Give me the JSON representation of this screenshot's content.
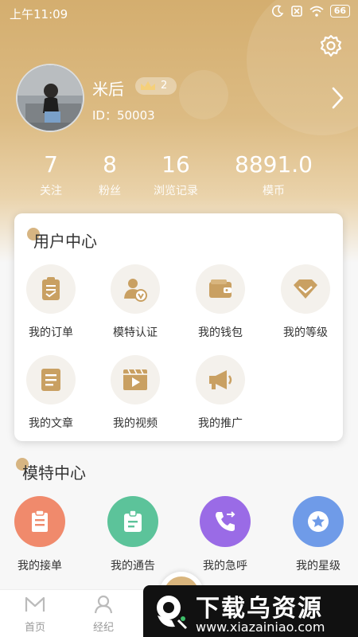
{
  "status_bar": {
    "time": "上午11:09",
    "battery": "66"
  },
  "profile": {
    "name": "米后",
    "vip_level": "2",
    "id_text": "ID：50003"
  },
  "stats": [
    {
      "value": "7",
      "label": "关注"
    },
    {
      "value": "8",
      "label": "粉丝"
    },
    {
      "value": "16",
      "label": "浏览记录"
    },
    {
      "value": "8891.0",
      "label": "模币"
    }
  ],
  "user_center": {
    "title": "用户中心",
    "items": [
      {
        "label": "我的订单",
        "icon": "clipboard-icon"
      },
      {
        "label": "模特认证",
        "icon": "user-verify-icon"
      },
      {
        "label": "我的钱包",
        "icon": "wallet-icon"
      },
      {
        "label": "我的等级",
        "icon": "diamond-icon"
      },
      {
        "label": "我的文章",
        "icon": "article-icon"
      },
      {
        "label": "我的视频",
        "icon": "video-icon"
      },
      {
        "label": "我的推广",
        "icon": "megaphone-icon"
      }
    ]
  },
  "model_center": {
    "title": "模特中心",
    "items": [
      {
        "label": "我的接单",
        "icon": "order-icon",
        "color": "#f08a6c"
      },
      {
        "label": "我的通告",
        "icon": "notice-icon",
        "color": "#5cc39a"
      },
      {
        "label": "我的急呼",
        "icon": "phone-icon",
        "color": "#9a6be6"
      },
      {
        "label": "我的星级",
        "icon": "star-icon",
        "color": "#6f9be8"
      }
    ]
  },
  "tabbar": {
    "tabs": [
      {
        "label": "首页"
      },
      {
        "label": "经纪"
      }
    ]
  },
  "watermark": {
    "title": "下载乌资源",
    "url": "www.xiazainiao.com"
  },
  "colors": {
    "gold": "#d4ae6f",
    "gold_light": "#e9c98f",
    "icon_bg": "#f4f1ec"
  }
}
